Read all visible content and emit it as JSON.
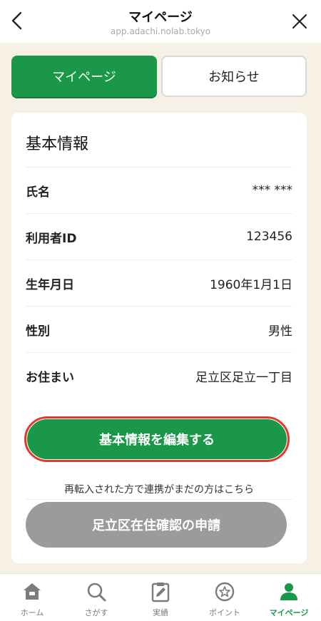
{
  "header": {
    "title": "マイページ",
    "url": "app.adachi.nolab.tokyo"
  },
  "tabs": [
    {
      "label": "マイページ",
      "active": true
    },
    {
      "label": "お知らせ",
      "active": false
    }
  ],
  "card": {
    "title": "基本情報",
    "rows": [
      {
        "label": "氏名",
        "value": "*** ***"
      },
      {
        "label": "利用者ID",
        "value": "123456"
      },
      {
        "label": "生年月日",
        "value": "1960年1月1日"
      },
      {
        "label": "性別",
        "value": "男性"
      },
      {
        "label": "お住まい",
        "value": "足立区足立一丁目"
      }
    ],
    "edit_button": "基本情報を編集する",
    "reentry_note": "再転入された方で連携がまだの方はこちら",
    "apply_button": "足立区在住確認の申請"
  },
  "bottom_nav": [
    {
      "label": "ホーム",
      "icon": "home-icon",
      "active": false
    },
    {
      "label": "さがす",
      "icon": "search-icon",
      "active": false
    },
    {
      "label": "実績",
      "icon": "record-icon",
      "active": false
    },
    {
      "label": "ポイント",
      "icon": "point-icon",
      "active": false
    },
    {
      "label": "マイページ",
      "icon": "user-icon",
      "active": true
    }
  ],
  "colors": {
    "brand_green": "#1a9748",
    "highlight_red": "#e23a2a",
    "page_bg": "#f6f1e4",
    "disabled_gray": "#9b9b9b"
  }
}
